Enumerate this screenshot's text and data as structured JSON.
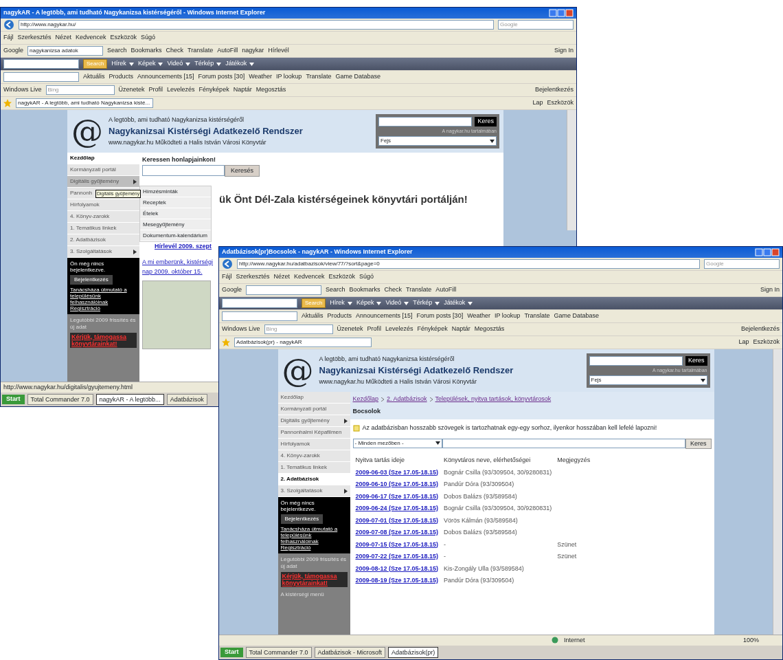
{
  "windows": [
    {
      "title": "nagykAR - A legtöbb, ami tudható Nagykanizsa kistérségéről - Windows Internet Explorer",
      "address": "http://www.nagykar.hu/",
      "search_placeholder": "Google",
      "menu": [
        "Fájl",
        "Szerkesztés",
        "Nézet",
        "Kedvencek",
        "Eszközök",
        "Súgó"
      ],
      "google_label": "Google",
      "google_value": "nagykanizsa adatok",
      "google_items": [
        "Search",
        "Bookmarks",
        "Check",
        "Translate",
        "AutoFill",
        "nagykar",
        "Hírlevél"
      ],
      "google_right": "Sign In",
      "dark_button": "Search",
      "dark_items": [
        "Hírek",
        "Képek",
        "Videó",
        "Térkép",
        "Játékok"
      ],
      "bar_items": [
        "Aktuális",
        "Products",
        "Announcements [15]",
        "Forum posts [30]",
        "Weather",
        "IP lookup",
        "Translate",
        "Game Database"
      ],
      "live_label": "Windows Live",
      "live_placeholder": "Bing",
      "live_items": [
        "Üzenetek",
        "Profil",
        "Levelezés",
        "Fényképek",
        "Naptár",
        "Megosztás"
      ],
      "live_right": "Bejelentkezés",
      "tab": "nagykAR - A legtöbb, ami tudható Nagykanizsa kisté...",
      "tab_tools": [
        "Lap",
        "Eszközök"
      ],
      "page": {
        "logo": "@",
        "tagline": "A legtöbb, ami tudható Nagykanizsa kistérségéről",
        "site_title": "Nagykanizsai Kistérségi Adatkezelő Rendszer",
        "subtitle": "www.nagykar.hu Működteti a Halis István Városi Könyvtár",
        "search_button": "Keres",
        "search_hint": "A nagykar.hu tartalmában",
        "select_value": "Fejs",
        "sidebar": [
          {
            "label": "Kezdőlap",
            "selected": true
          },
          {
            "label": "Kormányzati portál",
            "selected": false
          },
          {
            "label": "Digitális gyűjtemény",
            "selected": false,
            "expanded": true
          },
          {
            "label": "Pannonh",
            "selected": false
          },
          {
            "label": "Hírfolyamok",
            "selected": false
          },
          {
            "label": "4. Könyv-zarokk",
            "selected": false
          },
          {
            "label": "1. Tematikus linkek",
            "selected": false
          },
          {
            "label": "2. Adatbázisok",
            "selected": false
          },
          {
            "label": "3. Szolgáltatások",
            "selected": false,
            "expanded": false
          }
        ],
        "login": {
          "text": "Ön még nincs bejelentkezve.",
          "button": "Bejelentkezés",
          "link": "Tanácsháza útmutató a településünk felhasználóinak Regisztráció"
        },
        "notice": {
          "text": "Legutóbbi 2009 frissítés és új adat",
          "red": "Kérjük, támogassa könyvtárainkat!"
        },
        "main": {
          "kind": "home",
          "search_label": "Keressen honlapjainkon!",
          "search_button": "Keresés",
          "submenu": [
            "Hímzésminták",
            "Receptek",
            "Ételek",
            "Mesegyűjtemény",
            "Dokumentum-kalendárium"
          ],
          "tooltip": "Digitális gyűjtemény",
          "heading": "ük Önt Dél-Zala kistérségeinek könyvtári portálján!",
          "link": "Hírlevél 2009. szept",
          "news": "A mi emberünk, kistérségi",
          "news2": "nap 2009. október 15."
        }
      },
      "status": "http://www.nagykar.hu/digitalis/gyujtemeny.html",
      "taskbar": {
        "start": "Start",
        "items": [
          {
            "label": "Total Commander 7.0",
            "selected": false
          },
          {
            "label": "nagykAR - A legtöbb...",
            "selected": true
          },
          {
            "label": "Adatbázisok",
            "selected": false
          }
        ]
      }
    },
    {
      "title": "Adatbázisok(pr)Bocsolok - nagykAR - Windows Internet Explorer",
      "address": "http://www.nagykar.hu/adatbazisok/view/77/?sort&page=0",
      "search_placeholder": "Google",
      "menu": [
        "Fájl",
        "Szerkesztés",
        "Nézet",
        "Kedvencek",
        "Eszközök",
        "Súgó"
      ],
      "google_label": "Google",
      "google_items": [
        "Search",
        "Bookmarks",
        "Check",
        "Translate",
        "AutoFill"
      ],
      "google_right": "Sign In",
      "dark_button": "Search",
      "dark_items": [
        "Hírek",
        "Képek",
        "Videó",
        "Térkép",
        "Játékok"
      ],
      "bar_items": [
        "Aktuális",
        "Products",
        "Announcements [15]",
        "Forum posts [30]",
        "Weather",
        "IP lookup",
        "Translate",
        "Game Database"
      ],
      "live_label": "Windows Live",
      "live_placeholder": "Bing",
      "live_items": [
        "Üzenetek",
        "Profil",
        "Levelezés",
        "Fényképek",
        "Naptár",
        "Megosztás"
      ],
      "live_right": "Bejelentkezés",
      "tab": "Adatbázisok(pr) - nagykAR",
      "tab_tools": [
        "Lap",
        "Eszközök"
      ],
      "page": {
        "logo": "@",
        "tagline": "A legtöbb, ami tudható Nagykanizsa kistérségéről",
        "site_title": "Nagykanizsai Kistérségi Adatkezelő Rendszer",
        "subtitle": "www.nagykar.hu Működteti a Halis István Városi Könyvtár",
        "search_button": "Keres",
        "search_hint": "A nagykar.hu tartalmában",
        "select_value": "Fejs",
        "sidebar": [
          {
            "label": "Kezdőlap",
            "selected": false
          },
          {
            "label": "Kormányzati portál",
            "selected": false
          },
          {
            "label": "Digitális gyűjtemény",
            "selected": false,
            "expanded": false
          },
          {
            "label": "Pannonhalmi Képafilmen",
            "selected": false
          },
          {
            "label": "Hírfolyamok",
            "selected": false
          },
          {
            "label": "4. Könyv-zarokk",
            "selected": false
          },
          {
            "label": "1. Tematikus linkek",
            "selected": false
          },
          {
            "label": "2. Adatbázisok",
            "selected": true
          },
          {
            "label": "3. Szolgáltatások",
            "selected": false,
            "expanded": false
          }
        ],
        "login": {
          "text": "Ön még nincs bejelentkezve.",
          "button": "Bejelentkezés",
          "link": "Tanácsháza útmutató a településünk felhasználóinak Regisztráció"
        },
        "notice": {
          "text": "Legutóbbi 2009 frissítés és új adat",
          "red": "Kérjük, támogassa könyvtárainkat!",
          "extra": "A kistérségi menü"
        },
        "main": {
          "kind": "list",
          "breadcrumb": [
            "Kezdőlap",
            "2. Adatbázisok",
            "Települések, nyitva tartások, könyvtárosok"
          ],
          "heading": "Bocsolok",
          "info": "Az adatbázisban hosszabb szövegek is tartozhatnak egy-egy sorhoz, ilyenkor hosszában kell lefelé lapozni!",
          "filter_select": "- Minden mezőben -",
          "filter_button": "Keres",
          "columns": [
            "Nyitva tartás ideje",
            "Könyvtáros neve, elérhetőségei",
            "Megjegyzés"
          ],
          "rows": [
            [
              "2009-06-03 (Sze 17.05-18.15)",
              "Bognár Csilla (93/309504, 30/9280831)",
              ""
            ],
            [
              "2009-06-10 (Sze 17.05-18.15)",
              "Pandúr Dóra (93/309504)",
              ""
            ],
            [
              "2009-06-17 (Sze 17.05-18.15)",
              "Dobos Balázs (93/589584)",
              ""
            ],
            [
              "2009-06-24 (Sze 17.05-18.15)",
              "Bognár Csilla (93/309504, 30/9280831)",
              ""
            ],
            [
              "2009-07-01 (Sze 17.05-18.15)",
              "Vörös Kálmán (93/589584)",
              ""
            ],
            [
              "2009-07-08 (Sze 17.05-18.15)",
              "Dobos Balázs (93/589584)",
              ""
            ],
            [
              "2009-07-15 (Sze 17.05-18.15)",
              "-",
              "Szünet"
            ],
            [
              "2009-07-22 (Sze 17.05-18.15)",
              "-",
              "Szünet"
            ],
            [
              "2009-08-12 (Sze 17.05-18.15)",
              "Kis-Zongály Ulla (93/589584)",
              ""
            ],
            [
              "2009-08-19 (Sze 17.05-18.15)",
              "Pandúr Dóra (93/309504)",
              ""
            ]
          ]
        }
      },
      "status": "Internet",
      "zoom": "100%",
      "taskbar": {
        "start": "Start",
        "items": [
          {
            "label": "Total Commander 7.0",
            "selected": false
          },
          {
            "label": "Adatbázisok - Microsoft",
            "selected": false
          },
          {
            "label": "Adatbázisok(pr)",
            "selected": true
          }
        ]
      }
    }
  ]
}
